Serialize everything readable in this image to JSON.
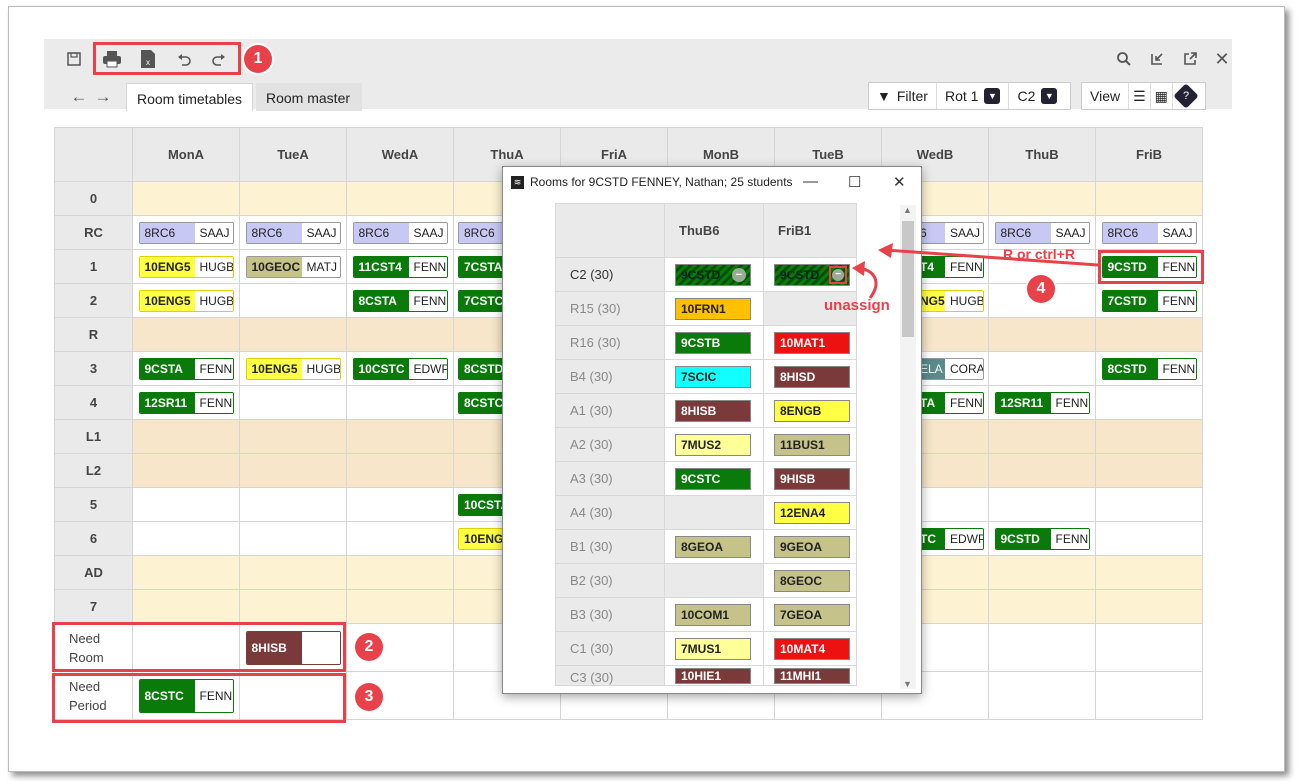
{
  "toolbar": {
    "tabs": [
      "Room timetables",
      "Room master"
    ],
    "filter_label": "Filter",
    "rot_label": "Rot 1",
    "c2_label": "C2",
    "view_label": "View"
  },
  "timetable": {
    "days": [
      "MonA",
      "TueA",
      "WedA",
      "ThuA",
      "FriA",
      "MonB",
      "TueB",
      "WedB",
      "ThuB",
      "FriB"
    ],
    "rows": [
      "0",
      "RC",
      "1",
      "2",
      "R",
      "3",
      "4",
      "L1",
      "L2",
      "5",
      "6",
      "AD",
      "7"
    ],
    "need_room_label": "Need Room",
    "need_period_label": "Need Period"
  },
  "cells": {
    "rc_mona": {
      "class": "8RC6",
      "teacher": "SAAJ"
    },
    "rc_tuea": {
      "class": "8RC6",
      "teacher": "SAAJ"
    },
    "rc_weda": {
      "class": "8RC6",
      "teacher": "SAAJ"
    },
    "rc_thua": {
      "class": "8RC6"
    },
    "rc_wedb": {
      "class": "6",
      "teacher": "SAAJ"
    },
    "rc_thub": {
      "class": "8RC6",
      "teacher": "SAAJ"
    },
    "rc_frib": {
      "class": "8RC6",
      "teacher": "SAAJ"
    },
    "p1_mona": {
      "class": "10ENG5",
      "teacher": "HUGB"
    },
    "p1_tuea": {
      "class": "10GEOC",
      "teacher": "MATJ"
    },
    "p1_weda": {
      "class": "11CST4",
      "teacher": "FENN"
    },
    "p1_thua": {
      "class": "7CSTA"
    },
    "p1_wedb": {
      "class": "T4",
      "teacher": "FENN"
    },
    "p1_frib": {
      "class": "9CSTD",
      "teacher": "FENN"
    },
    "p2_mona": {
      "class": "10ENG5",
      "teacher": "HUGB"
    },
    "p2_weda": {
      "class": "8CSTA",
      "teacher": "FENN"
    },
    "p2_thua": {
      "class": "7CSTC"
    },
    "p2_wedb": {
      "class": "NG5",
      "teacher": "HUGB"
    },
    "p2_frib": {
      "class": "7CSTD",
      "teacher": "FENN"
    },
    "p3_mona": {
      "class": "9CSTA",
      "teacher": "FENN"
    },
    "p3_tuea": {
      "class": "10ENG5",
      "teacher": "HUGB"
    },
    "p3_weda": {
      "class": "10CSTC",
      "teacher": "EDWP"
    },
    "p3_thua": {
      "class": "8CSTD"
    },
    "p3_wedb": {
      "class": "ELA",
      "teacher": "CORA"
    },
    "p3_frib": {
      "class": "8CSTD",
      "teacher": "FENN"
    },
    "p4_mona": {
      "class": "12SR11",
      "teacher": "FENN"
    },
    "p4_thua": {
      "class": "8CSTC"
    },
    "p4_wedb": {
      "class": "TA",
      "teacher": "FENN"
    },
    "p4_thub": {
      "class": "12SR11",
      "teacher": "FENN"
    },
    "p5_thua": {
      "class": "10CSTA"
    },
    "p6_thua": {
      "class": "10ENG5"
    },
    "p6_wedb": {
      "class": "TC",
      "teacher": "EDWP"
    },
    "p6_thub": {
      "class": "9CSTD",
      "teacher": "FENN"
    },
    "need_room": {
      "class": "8HISB"
    },
    "need_period": {
      "class": "8CSTC",
      "teacher": "FENN"
    }
  },
  "dialog": {
    "title": "Rooms for 9CSTD FENNEY, Nathan; 25 students",
    "cols": [
      "ThuB6",
      "FriB1"
    ],
    "rows": [
      {
        "room": "C2 (30)",
        "a": "9CSTD",
        "b": "9CSTD"
      },
      {
        "room": "R15 (30)",
        "a": "10FRN1",
        "b": ""
      },
      {
        "room": "R16 (30)",
        "a": "9CSTB",
        "b": "10MAT1"
      },
      {
        "room": "B4 (30)",
        "a": "7SCIC",
        "b": "8HISD"
      },
      {
        "room": "A1 (30)",
        "a": "8HISB",
        "b": "8ENGB"
      },
      {
        "room": "A2 (30)",
        "a": "7MUS2",
        "b": "11BUS1"
      },
      {
        "room": "A3 (30)",
        "a": "9CSTC",
        "b": "9HISB"
      },
      {
        "room": "A4 (30)",
        "a": "",
        "b": "12ENA4"
      },
      {
        "room": "B1 (30)",
        "a": "8GEOA",
        "b": "9GEOA"
      },
      {
        "room": "B2 (30)",
        "a": "",
        "b": "8GEOC"
      },
      {
        "room": "B3 (30)",
        "a": "10COM1",
        "b": "7GEOA"
      },
      {
        "room": "C1 (30)",
        "a": "7MUS1",
        "b": "10MAT4"
      },
      {
        "room": "C3 (30)",
        "a": "10HIE1",
        "b": "11MHI1"
      }
    ]
  },
  "annotations": {
    "n1": "1",
    "n2": "2",
    "n3": "3",
    "n4": "4",
    "shortcut": "R or ctrl+R",
    "unassign": "unassign"
  },
  "colors": {
    "green": "#0a7a0a",
    "yellow": "#ffff44",
    "olive": "#c5c28a",
    "lavender": "#c8c8f4",
    "brown": "#7b3a3a",
    "red": "#ee1111",
    "orange": "#ffc000",
    "cyan": "#11ffff",
    "lightyellow": "#ffff99",
    "accent": "#e8414a"
  }
}
